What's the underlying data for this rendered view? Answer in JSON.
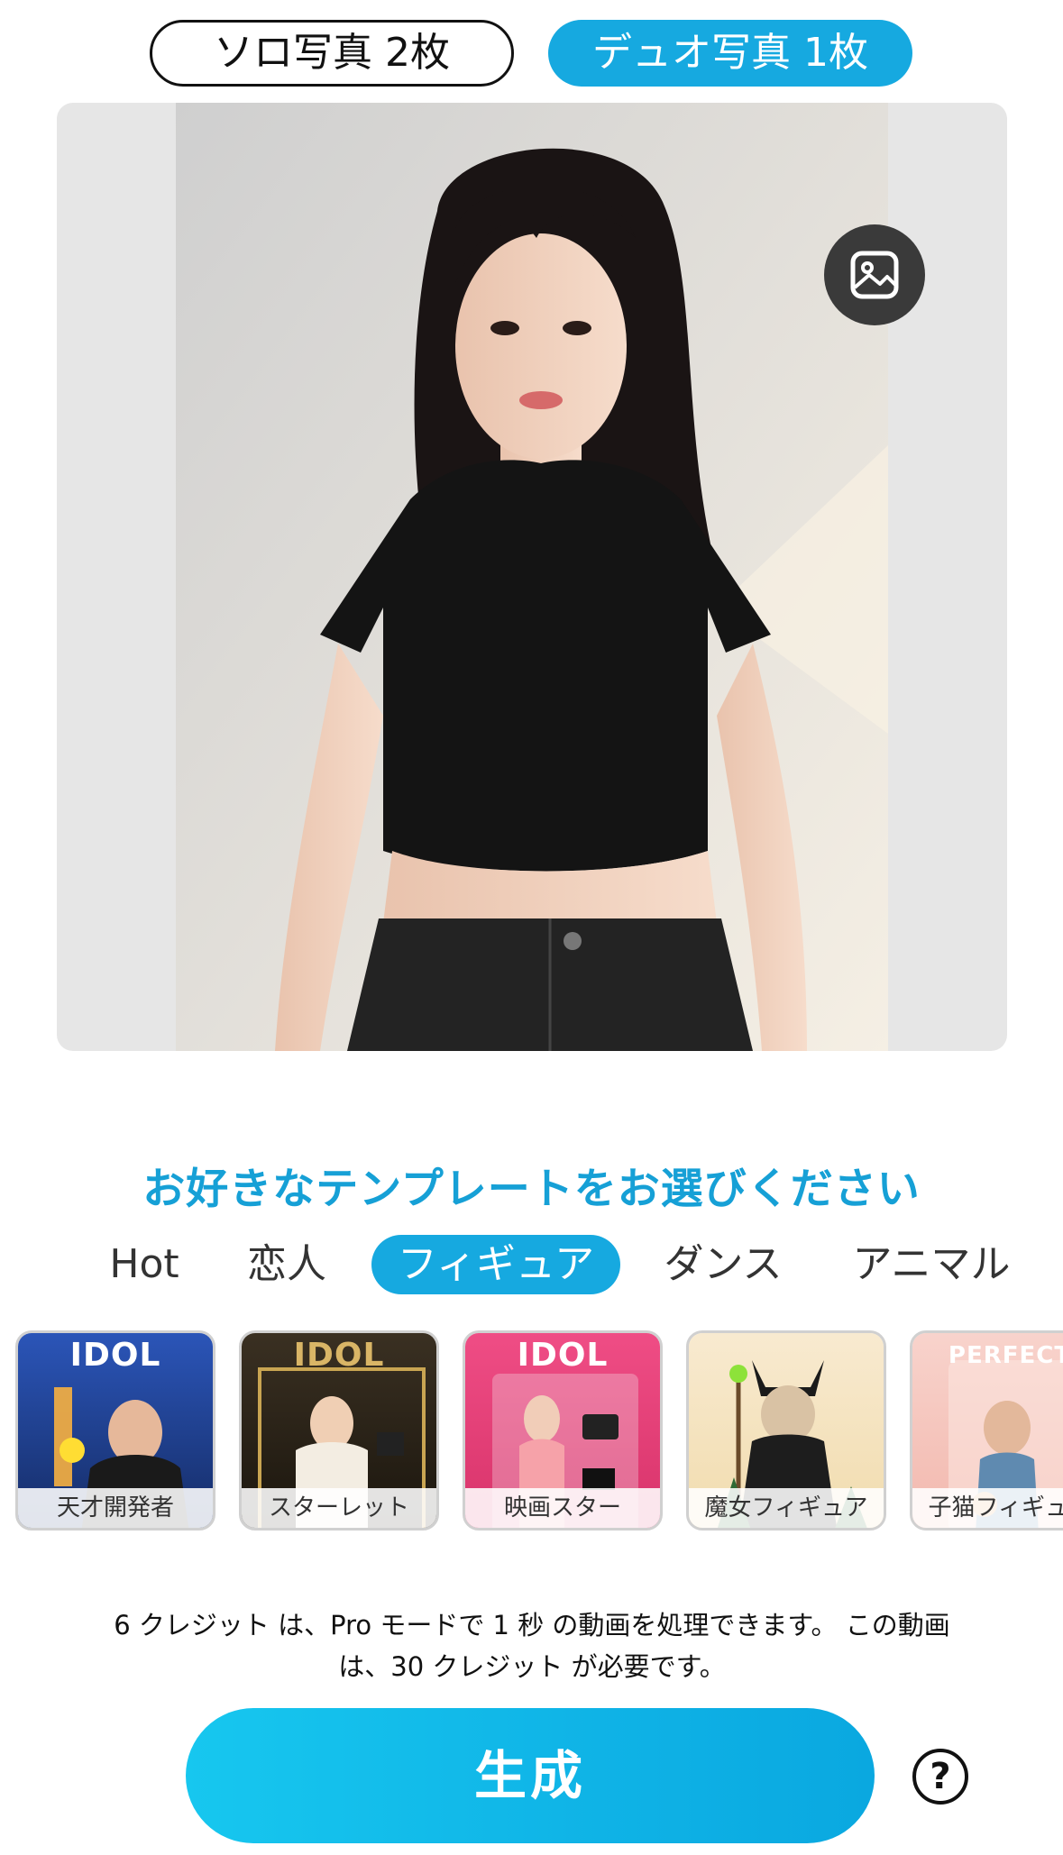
{
  "mode_toggle": {
    "solo_label": "ソロ写真 2枚",
    "duo_label": "デュオ写真 1枚",
    "selected": "duo"
  },
  "preview": {
    "gallery_icon": "image-gallery-icon"
  },
  "heading": "お好きなテンプレートをお選びください",
  "tabs": [
    {
      "label": "Hot",
      "active": false
    },
    {
      "label": "恋人",
      "active": false
    },
    {
      "label": "フィギュア",
      "active": true
    },
    {
      "label": "ダンス",
      "active": false
    },
    {
      "label": "アニマル",
      "active": false
    }
  ],
  "templates": [
    {
      "label": "天才開発者",
      "badge": "IDOL",
      "color": "#1e3f8f"
    },
    {
      "label": "スターレット",
      "badge": "IDOL",
      "color": "#2a2418"
    },
    {
      "label": "映画スター",
      "badge": "IDOL",
      "color": "#e83a74"
    },
    {
      "label": "魔女フィギュア",
      "badge": "",
      "color": "#f4e2b8"
    },
    {
      "label": "子猫フィギュア",
      "badge": "PERFECT",
      "color": "#f6c9c2"
    }
  ],
  "info": {
    "line1": "6 クレジット は、Pro モードで 1 秒 の動画を処理できます。 この動画",
    "line2": "は、30 クレジット が必要です。"
  },
  "generate_label": "生成",
  "help_label": "?",
  "colors": {
    "accent": "#16a9e0",
    "heading": "#16a0d6"
  }
}
